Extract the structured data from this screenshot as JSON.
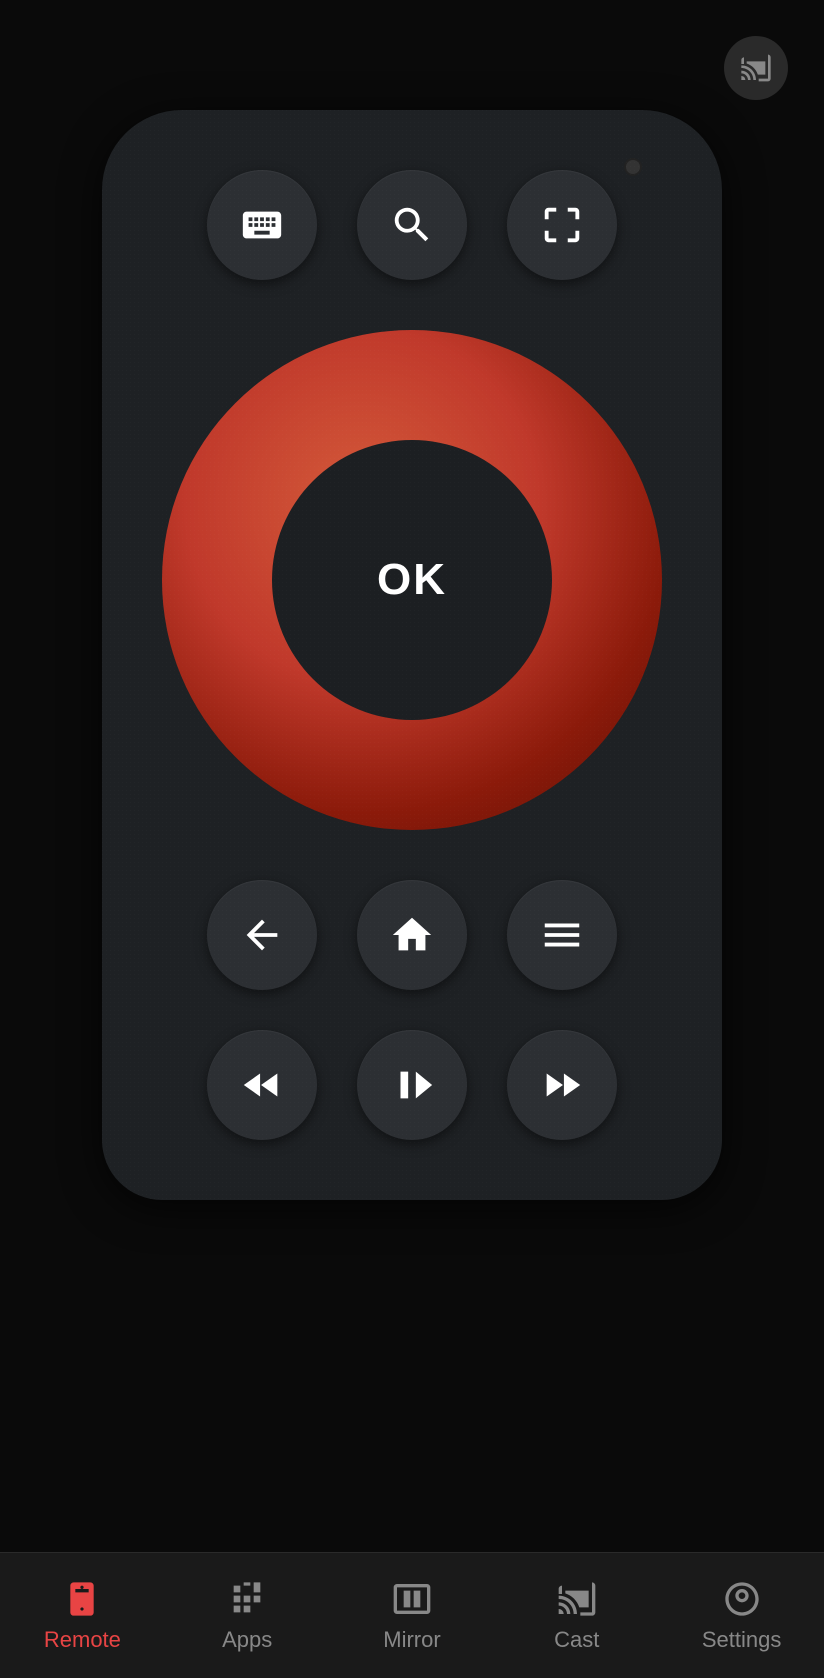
{
  "app": {
    "background": "#0a0a0a"
  },
  "top_bar": {
    "cast_button_title": "Cast"
  },
  "remote": {
    "led_color": "#333",
    "ok_label": "OK",
    "buttons": {
      "keyboard": "keyboard-icon",
      "search": "search-icon",
      "screen_fit": "screen-fit-icon",
      "back": "back-icon",
      "home": "home-icon",
      "menu": "menu-icon",
      "rewind": "rewind-icon",
      "play_pause": "play-pause-icon",
      "fast_forward": "fast-forward-icon"
    }
  },
  "bottom_nav": {
    "items": [
      {
        "id": "remote",
        "label": "Remote",
        "active": true
      },
      {
        "id": "apps",
        "label": "Apps",
        "active": false
      },
      {
        "id": "mirror",
        "label": "Mirror",
        "active": false
      },
      {
        "id": "cast",
        "label": "Cast",
        "active": false
      },
      {
        "id": "settings",
        "label": "Settings",
        "active": false
      }
    ]
  }
}
